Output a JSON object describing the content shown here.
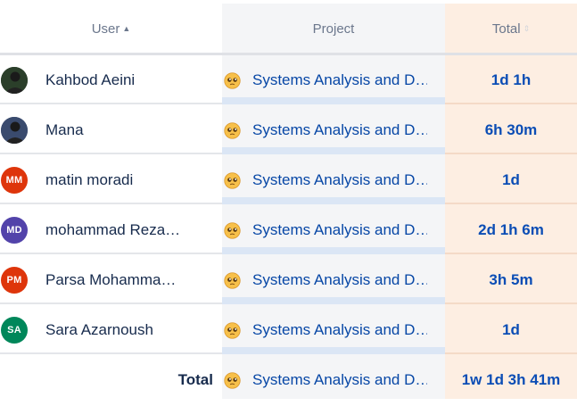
{
  "header": {
    "user": "User",
    "project": "Project",
    "total": "Total"
  },
  "rows": [
    {
      "name": "Kahbod Aeini",
      "initials": "",
      "avatar_color": "#2b3f2a",
      "project": "Systems Analysis and D…",
      "total": "1d 1h"
    },
    {
      "name": "Mana",
      "initials": "",
      "avatar_color": "#3a4b6e",
      "project": "Systems Analysis and D…",
      "total": "6h 30m"
    },
    {
      "name": "matin moradi",
      "initials": "MM",
      "avatar_color": "#de350b",
      "project": "Systems Analysis and D…",
      "total": "1d"
    },
    {
      "name": "mohammad Reza…",
      "initials": "MD",
      "avatar_color": "#5243aa",
      "project": "Systems Analysis and D…",
      "total": "2d 1h 6m"
    },
    {
      "name": "Parsa Mohamma…",
      "initials": "PM",
      "avatar_color": "#de350b",
      "project": "Systems Analysis and D…",
      "total": "3h 5m"
    },
    {
      "name": "Sara Azarnoush",
      "initials": "SA",
      "avatar_color": "#00875a",
      "project": "Systems Analysis and D…",
      "total": "1d"
    }
  ],
  "footer": {
    "label": "Total",
    "project": "Systems Analysis and D…",
    "total": "1w 1d 3h 41m"
  },
  "icons": {
    "sort_user": "sort-ascending-icon",
    "sort_total": "sort-unsorted-icon",
    "project_icon": "pleading-face-emoji-icon"
  },
  "colors": {
    "project_link": "#0747a6",
    "total_text": "#0b4db5",
    "total_column_bg": "#fdeee2",
    "project_column_bg": "#f4f5f7"
  }
}
